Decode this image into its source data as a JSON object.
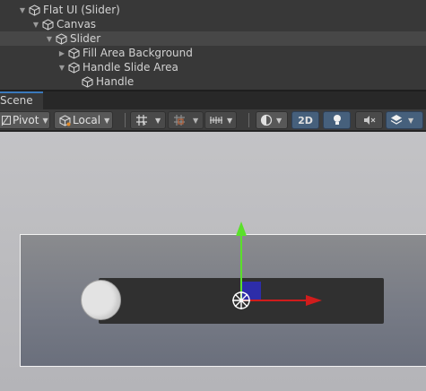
{
  "hierarchy": {
    "items": [
      {
        "label": "Flat UI (Slider)",
        "expanded": true
      },
      {
        "label": "Canvas",
        "expanded": true
      },
      {
        "label": "Slider",
        "expanded": true,
        "selected": true
      },
      {
        "label": "Fill Area Background",
        "expanded": false
      },
      {
        "label": "Handle Slide Area",
        "expanded": true
      },
      {
        "label": "Handle",
        "expanded": null
      }
    ]
  },
  "tabs": {
    "scene_label": "Scene"
  },
  "toolbar": {
    "pivot_label": "Pivot",
    "local_label": "Local",
    "mode_2d_label": "2D",
    "icons": [
      "pivot-icon",
      "local-icon",
      "grid-snap-icon",
      "increment-snap-icon",
      "ruler-icon",
      "shading-icon",
      "light-icon",
      "audio-mute-icon",
      "layers-icon"
    ]
  },
  "colors": {
    "accent": "#3a79bb",
    "gizmo_x": "#d01c1c",
    "gizmo_y": "#5ae02a",
    "gizmo_center": "#2d2dbe"
  }
}
